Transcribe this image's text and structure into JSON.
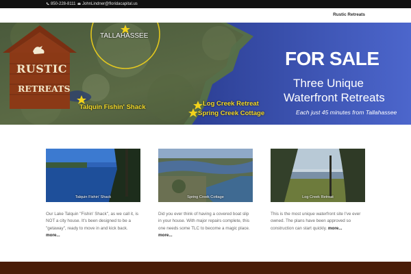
{
  "topbar": {
    "phone": "850-228-8111",
    "email": "JohnLindner@floridacapital.us",
    "icons": {
      "phone": "phone-icon",
      "email": "envelope-icon"
    }
  },
  "nav": {
    "items": [
      {
        "label": "Rustic Retreats"
      }
    ]
  },
  "hero": {
    "logo": {
      "line1": "RUSTIC",
      "line2": "RETREATS"
    },
    "map_labels": {
      "tallahassee": "TALLAHASSEE",
      "talquin": "Talquin Fishin' Shack",
      "log_creek": "Log Creek Retreat",
      "spring_creek": "Spring Creek Cottage"
    },
    "headline": "FOR SALE",
    "subhead_line1": "Three Unique",
    "subhead_line2": "Waterfront Retreats",
    "tagline": "Each just 45 minutes from Tallahassee"
  },
  "cards": [
    {
      "photo_label": "Talquin Fishin' Shack",
      "text": "Our Lake Talquin \"Fishin' Shack\", as we call it, is NOT a city house. It's been designed to be a \"getaway\", ready to move in and kick back.",
      "more": "more..."
    },
    {
      "photo_label": "Spring Creek Cottage",
      "text": "Did you ever think of having a covered boat slip in your house. With major repairs complete, this one needs some TLC to become a magic place.",
      "more": "more..."
    },
    {
      "photo_label": "Log Creek Retreat",
      "text": "This is the most unique waterfront site I've ever owned. The plans have been approved so construction can start quickly.",
      "more": "more..."
    }
  ],
  "colors": {
    "topbar": "#111111",
    "footer": "#4a1c08",
    "star": "#f2d21b",
    "label_yellow": "#f6dc2a",
    "sea": "#3a4fb0"
  }
}
